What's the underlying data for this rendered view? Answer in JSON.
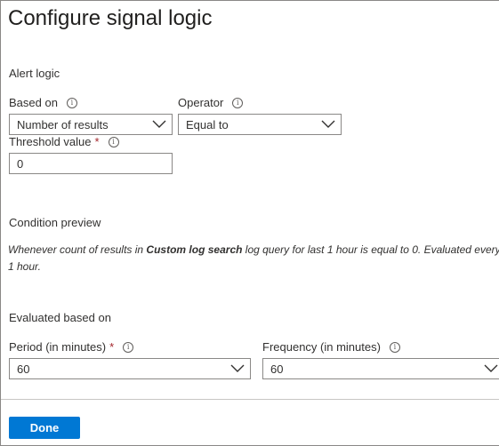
{
  "panel": {
    "title": "Configure signal logic"
  },
  "alert_logic": {
    "heading": "Alert logic",
    "based_on": {
      "label": "Based on",
      "value": "Number of results"
    },
    "operator": {
      "label": "Operator",
      "value": "Equal to"
    },
    "threshold": {
      "label": "Threshold value",
      "required_mark": "*",
      "value": "0"
    }
  },
  "condition_preview": {
    "heading": "Condition preview",
    "text_prefix": "Whenever count of results in ",
    "text_bold": "Custom log search",
    "text_suffix": " log query for last 1 hour is equal to 0. Evaluated every 1 hour."
  },
  "evaluated": {
    "heading": "Evaluated based on",
    "period": {
      "label": "Period (in minutes)",
      "required_mark": "*",
      "value": "60"
    },
    "frequency": {
      "label": "Frequency (in minutes)",
      "value": "60"
    }
  },
  "footer": {
    "done_label": "Done"
  },
  "icons": {
    "info": "info-icon",
    "chevron": "chevron-down-icon"
  },
  "colors": {
    "accent": "#0078d4",
    "required": "#a4262c",
    "border": "#8a8886"
  }
}
